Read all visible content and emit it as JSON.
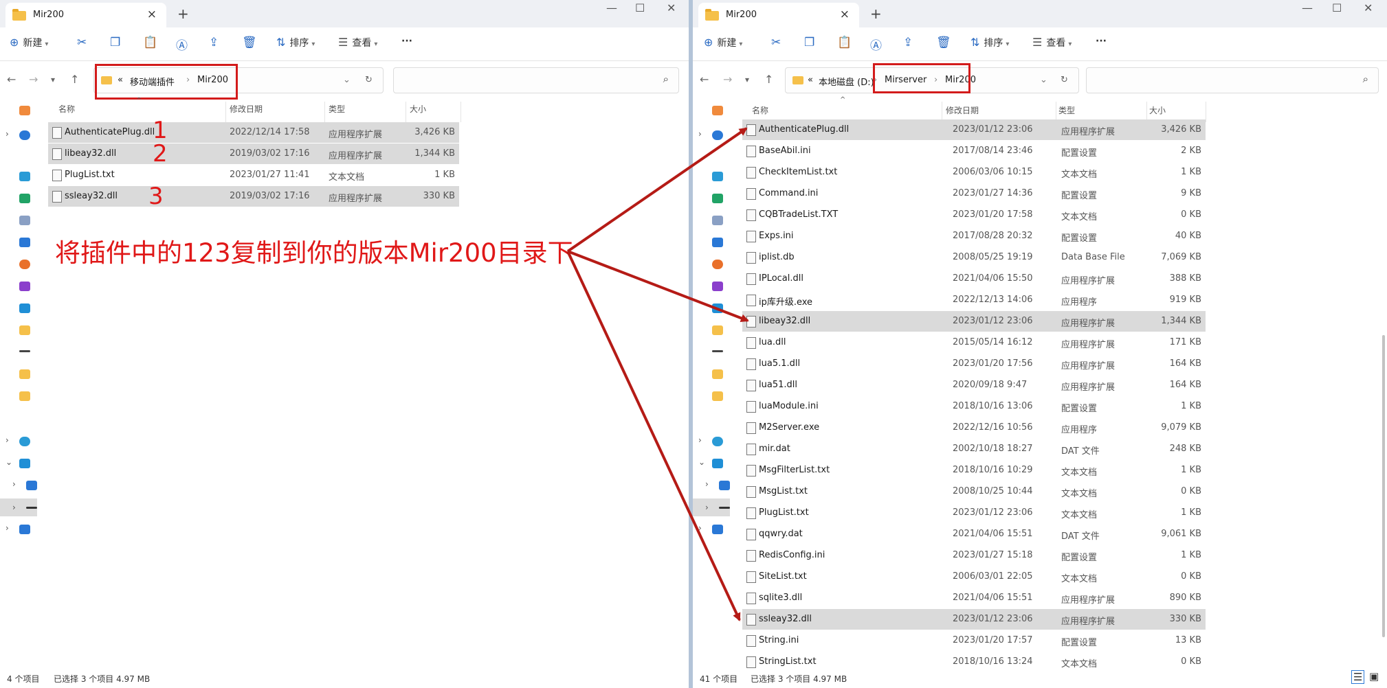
{
  "left_window": {
    "tab_title": "Mir200",
    "toolbar": {
      "new_label": "新建",
      "sort_label": "排序",
      "view_label": "查看"
    },
    "breadcrumb": [
      "«",
      "移动端插件",
      "Mir200"
    ],
    "columns": {
      "name": "名称",
      "date": "修改日期",
      "type": "类型",
      "size": "大小"
    },
    "files": [
      {
        "name": "AuthenticatePlug.dll",
        "date": "2022/12/14 17:58",
        "type": "应用程序扩展",
        "size": "3,426 KB",
        "selected": true
      },
      {
        "name": "libeay32.dll",
        "date": "2019/03/02 17:16",
        "type": "应用程序扩展",
        "size": "1,344 KB",
        "selected": true
      },
      {
        "name": "PlugList.txt",
        "date": "2023/01/27 11:41",
        "type": "文本文档",
        "size": "1 KB",
        "selected": false
      },
      {
        "name": "ssleay32.dll",
        "date": "2019/03/02 17:16",
        "type": "应用程序扩展",
        "size": "330 KB",
        "selected": true
      }
    ],
    "status": {
      "count": "4 个项目",
      "selection": "已选择 3 个项目  4.97 MB"
    }
  },
  "right_window": {
    "tab_title": "Mir200",
    "toolbar": {
      "new_label": "新建",
      "sort_label": "排序",
      "view_label": "查看"
    },
    "breadcrumb": [
      "«",
      "本地磁盘 (D:)",
      "Mirserver",
      "Mir200"
    ],
    "columns": {
      "name": "名称",
      "date": "修改日期",
      "type": "类型",
      "size": "大小"
    },
    "files": [
      {
        "name": "AuthenticatePlug.dll",
        "date": "2023/01/12 23:06",
        "type": "应用程序扩展",
        "size": "3,426 KB",
        "selected": true
      },
      {
        "name": "BaseAbil.ini",
        "date": "2017/08/14 23:46",
        "type": "配置设置",
        "size": "2 KB",
        "selected": false
      },
      {
        "name": "CheckItemList.txt",
        "date": "2006/03/06 10:15",
        "type": "文本文档",
        "size": "1 KB",
        "selected": false
      },
      {
        "name": "Command.ini",
        "date": "2023/01/27 14:36",
        "type": "配置设置",
        "size": "9 KB",
        "selected": false
      },
      {
        "name": "CQBTradeList.TXT",
        "date": "2023/01/20 17:58",
        "type": "文本文档",
        "size": "0 KB",
        "selected": false
      },
      {
        "name": "Exps.ini",
        "date": "2017/08/28 20:32",
        "type": "配置设置",
        "size": "40 KB",
        "selected": false
      },
      {
        "name": "iplist.db",
        "date": "2008/05/25 19:19",
        "type": "Data Base File",
        "size": "7,069 KB",
        "selected": false
      },
      {
        "name": "IPLocal.dll",
        "date": "2021/04/06 15:50",
        "type": "应用程序扩展",
        "size": "388 KB",
        "selected": false
      },
      {
        "name": "ip库升级.exe",
        "date": "2022/12/13 14:06",
        "type": "应用程序",
        "size": "919 KB",
        "selected": false
      },
      {
        "name": "libeay32.dll",
        "date": "2023/01/12 23:06",
        "type": "应用程序扩展",
        "size": "1,344 KB",
        "selected": true
      },
      {
        "name": "lua.dll",
        "date": "2015/05/14 16:12",
        "type": "应用程序扩展",
        "size": "171 KB",
        "selected": false
      },
      {
        "name": "lua5.1.dll",
        "date": "2023/01/20 17:56",
        "type": "应用程序扩展",
        "size": "164 KB",
        "selected": false
      },
      {
        "name": "lua51.dll",
        "date": "2020/09/18 9:47",
        "type": "应用程序扩展",
        "size": "164 KB",
        "selected": false
      },
      {
        "name": "luaModule.ini",
        "date": "2018/10/16 13:06",
        "type": "配置设置",
        "size": "1 KB",
        "selected": false
      },
      {
        "name": "M2Server.exe",
        "date": "2022/12/16 10:56",
        "type": "应用程序",
        "size": "9,079 KB",
        "selected": false
      },
      {
        "name": "mir.dat",
        "date": "2002/10/18 18:27",
        "type": "DAT 文件",
        "size": "248 KB",
        "selected": false
      },
      {
        "name": "MsgFilterList.txt",
        "date": "2018/10/16 10:29",
        "type": "文本文档",
        "size": "1 KB",
        "selected": false
      },
      {
        "name": "MsgList.txt",
        "date": "2008/10/25 10:44",
        "type": "文本文档",
        "size": "0 KB",
        "selected": false
      },
      {
        "name": "PlugList.txt",
        "date": "2023/01/12 23:06",
        "type": "文本文档",
        "size": "1 KB",
        "selected": false
      },
      {
        "name": "qqwry.dat",
        "date": "2021/04/06 15:51",
        "type": "DAT 文件",
        "size": "9,061 KB",
        "selected": false
      },
      {
        "name": "RedisConfig.ini",
        "date": "2023/01/27 15:18",
        "type": "配置设置",
        "size": "1 KB",
        "selected": false
      },
      {
        "name": "SiteList.txt",
        "date": "2006/03/01 22:05",
        "type": "文本文档",
        "size": "0 KB",
        "selected": false
      },
      {
        "name": "sqlite3.dll",
        "date": "2021/04/06 15:51",
        "type": "应用程序扩展",
        "size": "890 KB",
        "selected": false
      },
      {
        "name": "ssleay32.dll",
        "date": "2023/01/12 23:06",
        "type": "应用程序扩展",
        "size": "330 KB",
        "selected": true
      },
      {
        "name": "String.ini",
        "date": "2023/01/20 17:57",
        "type": "配置设置",
        "size": "13 KB",
        "selected": false
      },
      {
        "name": "StringList.txt",
        "date": "2018/10/16 13:24",
        "type": "文本文档",
        "size": "0 KB",
        "selected": false
      }
    ],
    "status": {
      "count": "41 个项目",
      "selection": "已选择 3 个项目  4.97 MB"
    }
  },
  "annotation": {
    "numbers": [
      "1",
      "2",
      "3"
    ],
    "instruction": "将插件中的123复制到你的版本Mir200目录下",
    "color": "#e01818"
  }
}
